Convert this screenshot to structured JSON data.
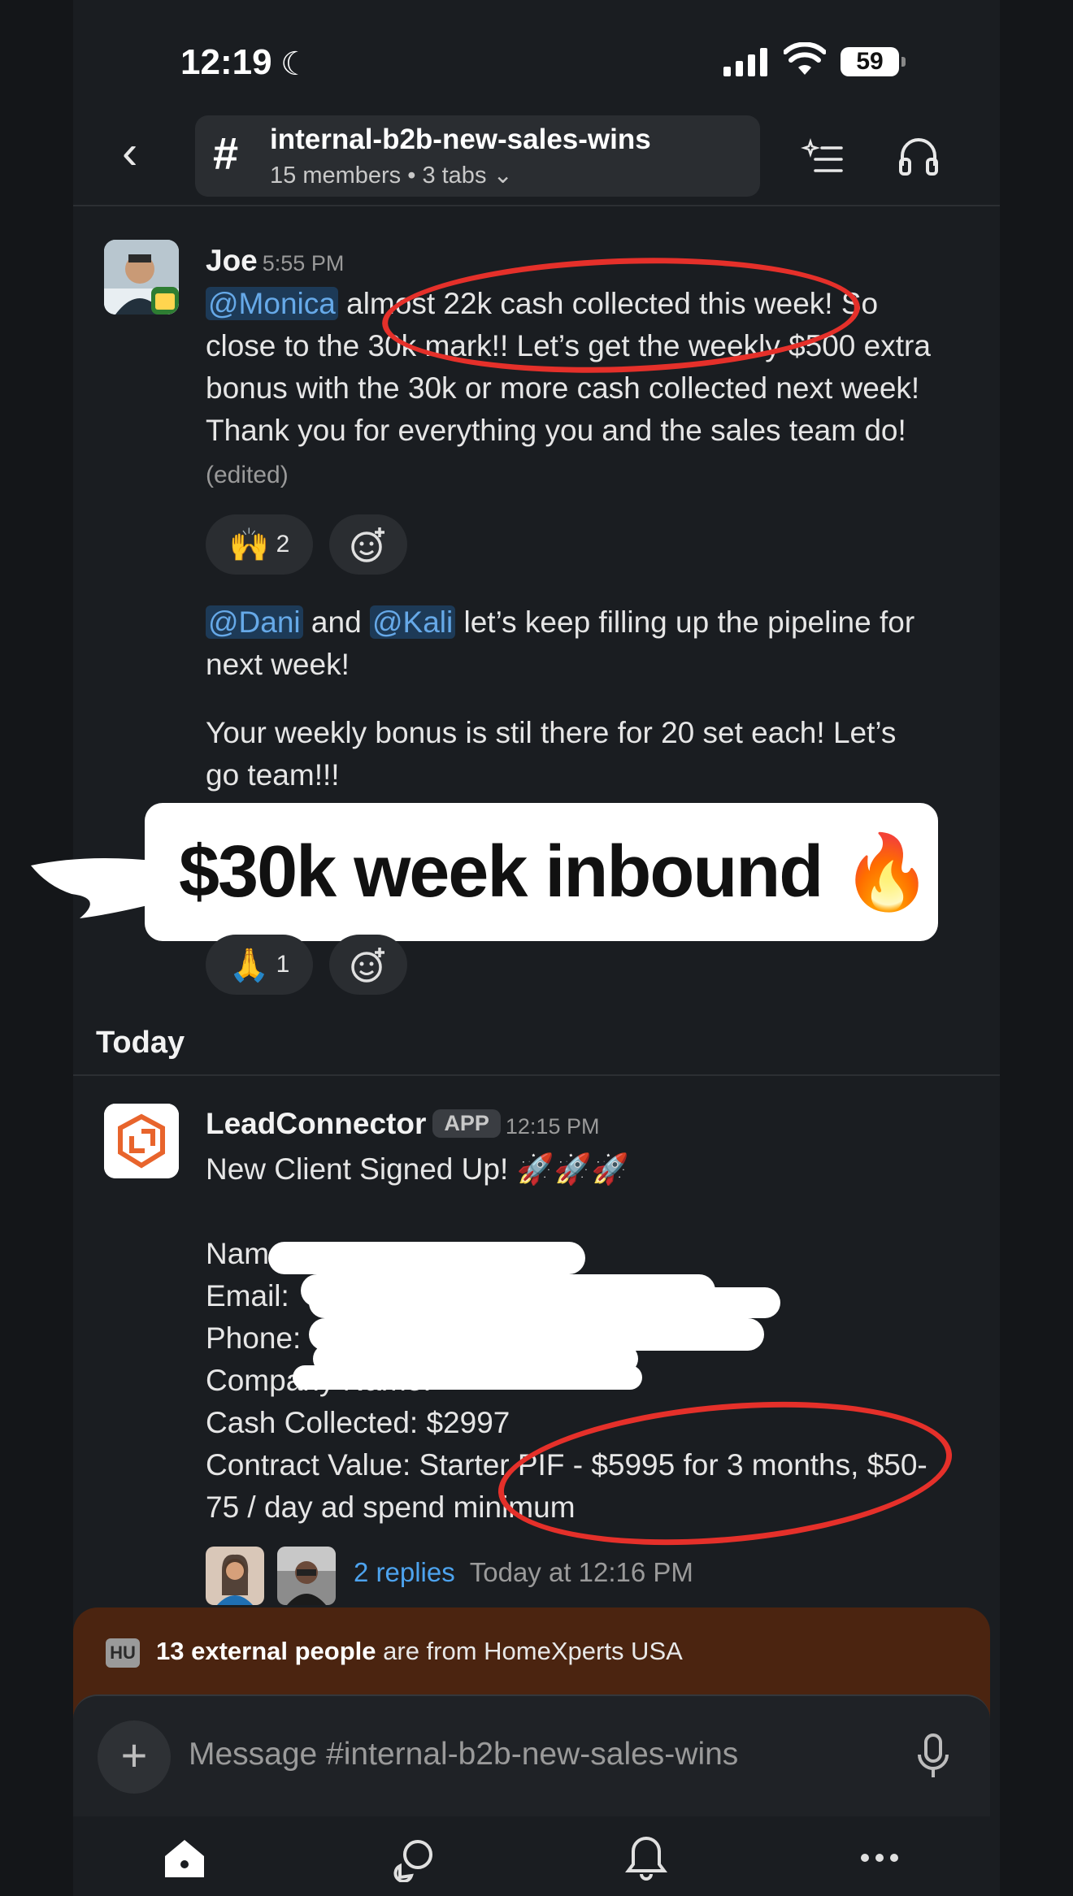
{
  "status_bar": {
    "time": "12:19",
    "battery": "59"
  },
  "header": {
    "channel_name": "internal-b2b-new-sales-wins",
    "meta": "15 members • 3 tabs ⌄"
  },
  "messages": [
    {
      "author": "Joe",
      "time": "5:55 PM",
      "paragraph1": {
        "mention": "@Monica",
        "text": " almost 22k cash collected this week! So close to the 30k mark!! Let’s get the weekly $500 extra bonus with the 30k or more cash collected next week! Thank you for everything you and the sales team do! ",
        "edited": "(edited)"
      },
      "reaction1": {
        "emoji": "🙌",
        "count": "2"
      },
      "paragraph2": {
        "mention1": "@Dani",
        "and": " and ",
        "mention2": "@Kali",
        "text": " let’s keep filling up the pipeline for next week!"
      },
      "paragraph3": "Your weekly bonus is stil there for 20 set each! Let’s go team!!!",
      "reaction2": {
        "emoji": "🙏",
        "count": "1"
      }
    },
    {
      "author": "LeadConnector",
      "badge": "APP",
      "time": "12:15 PM",
      "lines": [
        "New Client Signed Up! 🚀🚀🚀",
        "",
        "Nam",
        "Email:",
        "Phone:",
        "Company Name:",
        "Cash Collected: $2997",
        "Contract Value: Starter PIF - $5995 for 3 months, $50-75 / day ad spend minimum"
      ],
      "replies": "2 replies",
      "reply_time": "Today at 12:16 PM"
    }
  ],
  "sticker": {
    "text": "$30k week inbound",
    "emoji": "🔥"
  },
  "day_divider": "Today",
  "external_banner": {
    "tag": "HU",
    "bold": "13 external people",
    "text": " are from HomeXperts USA"
  },
  "composer": {
    "placeholder": "Message #internal-b2b-new-sales-wins"
  },
  "colors": {
    "background": "#1a1d21",
    "mention": "#66a9e8",
    "annotation_red": "#e5302a",
    "banner": "#4b2410"
  }
}
